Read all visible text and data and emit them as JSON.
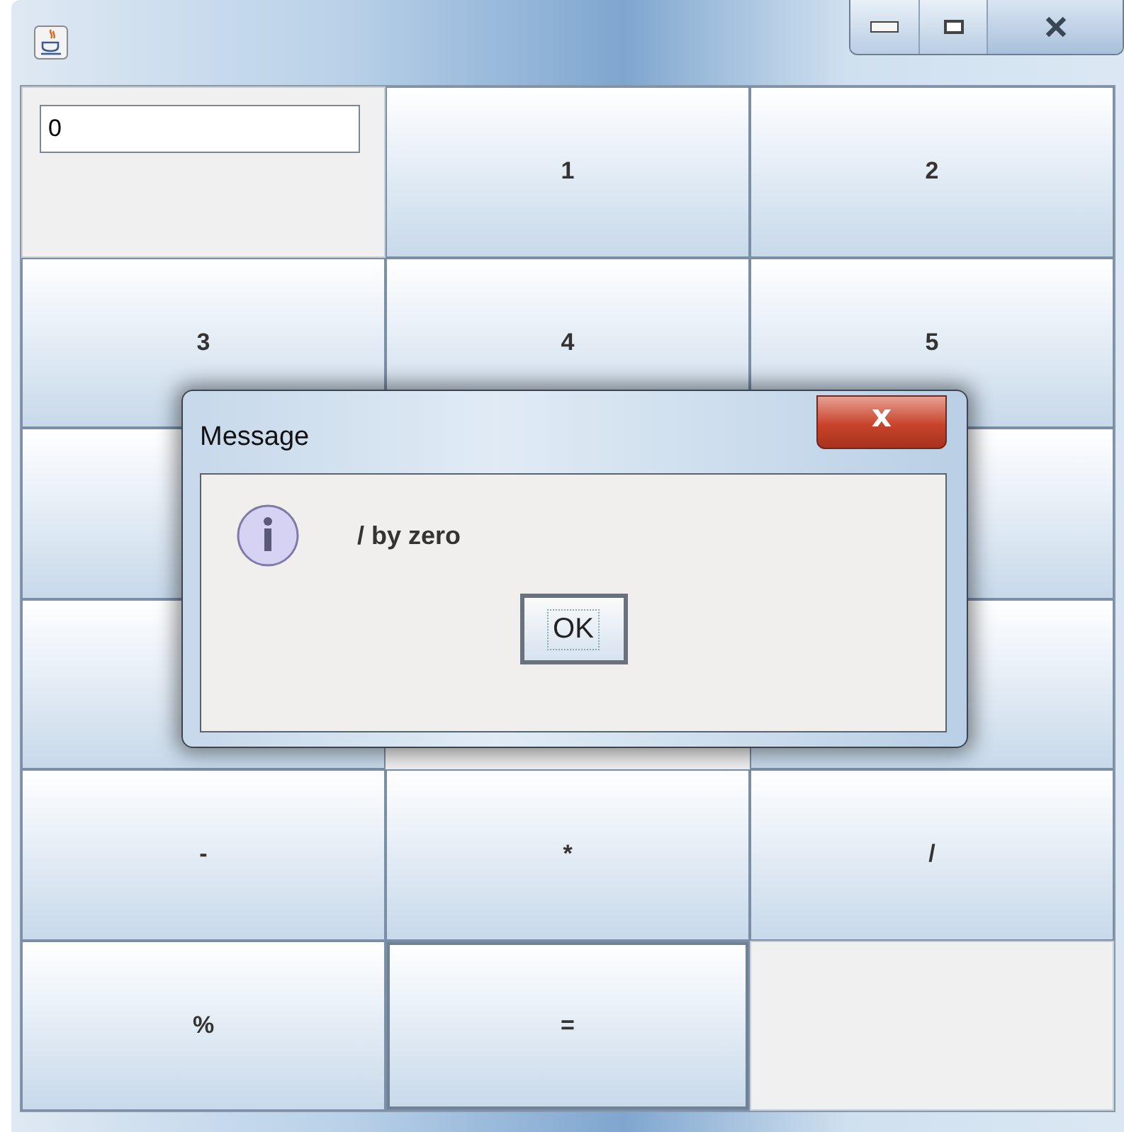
{
  "display": {
    "value": "0"
  },
  "keys": [
    {
      "kind": "display"
    },
    {
      "kind": "button",
      "label": "1",
      "focused": false
    },
    {
      "kind": "button",
      "label": "2",
      "focused": false
    },
    {
      "kind": "button",
      "label": "3",
      "focused": false
    },
    {
      "kind": "button",
      "label": "4",
      "focused": false
    },
    {
      "kind": "button",
      "label": "5",
      "focused": false
    },
    {
      "kind": "button"
    },
    {
      "kind": "button"
    },
    {
      "kind": "button"
    },
    {
      "kind": "button"
    },
    {
      "kind": "button",
      "label": "-",
      "focused": false
    },
    {
      "kind": "button",
      "label": "*",
      "focused": false
    },
    {
      "kind": "button",
      "label": "/",
      "focused": false
    },
    {
      "kind": "button",
      "label": "%",
      "focused": false
    },
    {
      "kind": "button",
      "label": "=",
      "focused": true
    },
    {
      "kind": "empty"
    }
  ],
  "dialog": {
    "title": "Message",
    "close": "x",
    "message": "/ by zero",
    "button": "OK"
  }
}
